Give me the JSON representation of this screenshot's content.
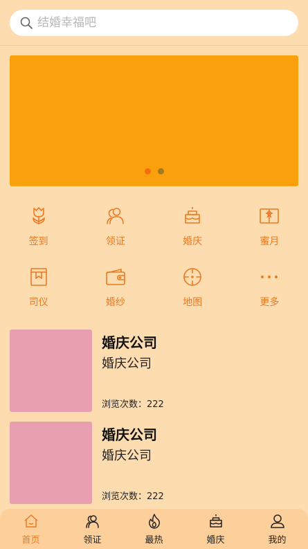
{
  "search": {
    "placeholder": "结婚幸福吧"
  },
  "banner": {
    "color": "#f9a00c",
    "indicator_colors": [
      "#f07010",
      "#a07a20"
    ]
  },
  "categories": [
    {
      "label": "签到",
      "icon": "tulip-icon"
    },
    {
      "label": "领证",
      "icon": "people-icon"
    },
    {
      "label": "婚庆",
      "icon": "cake-icon"
    },
    {
      "label": "蜜月",
      "icon": "gift-box-icon"
    },
    {
      "label": "司仪",
      "icon": "frame-icon"
    },
    {
      "label": "婚纱",
      "icon": "wallet-icon"
    },
    {
      "label": "地图",
      "icon": "target-icon"
    },
    {
      "label": "更多",
      "icon": "more-dots-icon"
    }
  ],
  "list": [
    {
      "title": "婚庆公司",
      "subtitle": "婚庆公司",
      "views": "浏览次数：222"
    },
    {
      "title": "婚庆公司",
      "subtitle": "婚庆公司",
      "views": "浏览次数：222"
    }
  ],
  "tabbar": [
    {
      "label": "首页",
      "icon": "home-icon",
      "active": true
    },
    {
      "label": "领证",
      "icon": "people-icon",
      "active": false
    },
    {
      "label": "最热",
      "icon": "flame-icon",
      "active": false
    },
    {
      "label": "婚庆",
      "icon": "cake-icon",
      "active": false
    },
    {
      "label": "我的",
      "icon": "user-icon",
      "active": false
    }
  ],
  "colors": {
    "accent": "#ea7a22",
    "background": "#fddcb0",
    "thumb": "#e8a0b0"
  }
}
